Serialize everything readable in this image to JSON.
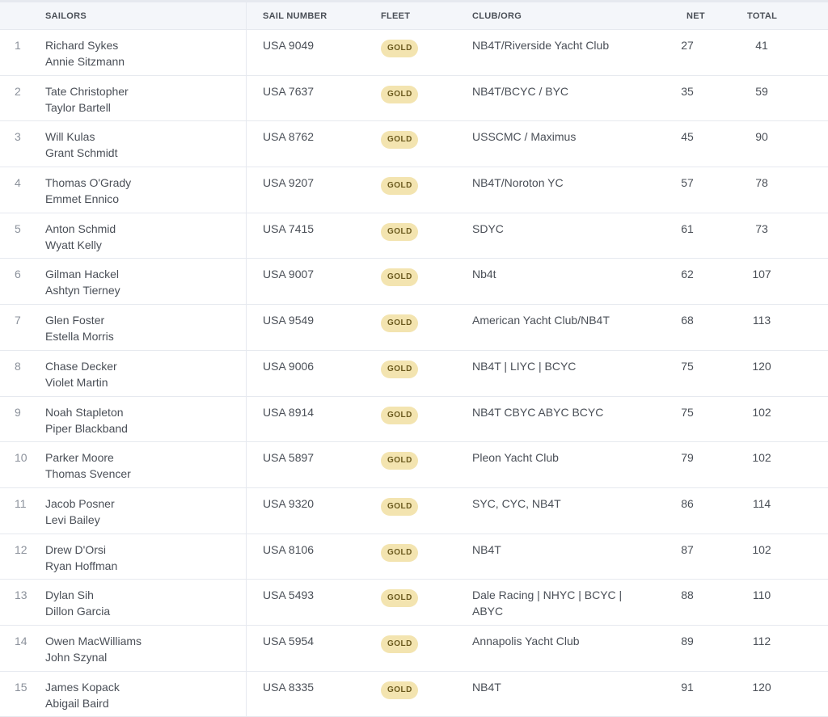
{
  "headers": {
    "sailors": "SAILORS",
    "sail_number": "SAIL NUMBER",
    "fleet": "FLEET",
    "club": "CLUB/ORG",
    "net": "NET",
    "total": "TOTAL"
  },
  "rows": [
    {
      "rank": "1",
      "skipper": "Richard Sykes",
      "crew": "Annie Sitzmann",
      "sail": "USA 9049",
      "fleet": "GOLD",
      "club": "NB4T/Riverside Yacht Club",
      "net": "27",
      "total": "41"
    },
    {
      "rank": "2",
      "skipper": "Tate Christopher",
      "crew": "Taylor Bartell",
      "sail": "USA 7637",
      "fleet": "GOLD",
      "club": "NB4T/BCYC / BYC",
      "net": "35",
      "total": "59"
    },
    {
      "rank": "3",
      "skipper": "Will Kulas",
      "crew": "Grant Schmidt",
      "sail": "USA 8762",
      "fleet": "GOLD",
      "club": "USSCMC / Maximus",
      "net": "45",
      "total": "90"
    },
    {
      "rank": "4",
      "skipper": "Thomas O'Grady",
      "crew": "Emmet Ennico",
      "sail": "USA 9207",
      "fleet": "GOLD",
      "club": "NB4T/Noroton YC",
      "net": "57",
      "total": "78"
    },
    {
      "rank": "5",
      "skipper": "Anton Schmid",
      "crew": "Wyatt Kelly",
      "sail": "USA 7415",
      "fleet": "GOLD",
      "club": "SDYC",
      "net": "61",
      "total": "73"
    },
    {
      "rank": "6",
      "skipper": "Gilman Hackel",
      "crew": "Ashtyn Tierney",
      "sail": "USA 9007",
      "fleet": "GOLD",
      "club": "Nb4t",
      "net": "62",
      "total": "107"
    },
    {
      "rank": "7",
      "skipper": "Glen Foster",
      "crew": "Estella Morris",
      "sail": "USA 9549",
      "fleet": "GOLD",
      "club": "American Yacht Club/NB4T",
      "net": "68",
      "total": "113"
    },
    {
      "rank": "8",
      "skipper": "Chase Decker",
      "crew": "Violet Martin",
      "sail": "USA 9006",
      "fleet": "GOLD",
      "club": "NB4T | LIYC | BCYC",
      "net": "75",
      "total": "120"
    },
    {
      "rank": "9",
      "skipper": "Noah Stapleton",
      "crew": "Piper Blackband",
      "sail": "USA 8914",
      "fleet": "GOLD",
      "club": "NB4T CBYC ABYC BCYC",
      "net": "75",
      "total": "102"
    },
    {
      "rank": "10",
      "skipper": "Parker Moore",
      "crew": "Thomas Svencer",
      "sail": "USA 5897",
      "fleet": "GOLD",
      "club": "Pleon Yacht Club",
      "net": "79",
      "total": "102"
    },
    {
      "rank": "11",
      "skipper": "Jacob Posner",
      "crew": "Levi Bailey",
      "sail": "USA 9320",
      "fleet": "GOLD",
      "club": "SYC, CYC, NB4T",
      "net": "86",
      "total": "114"
    },
    {
      "rank": "12",
      "skipper": "Drew D'Orsi",
      "crew": "Ryan Hoffman",
      "sail": "USA 8106",
      "fleet": "GOLD",
      "club": "NB4T",
      "net": "87",
      "total": "102"
    },
    {
      "rank": "13",
      "skipper": "Dylan Sih",
      "crew": "Dillon Garcia",
      "sail": "USA 5493",
      "fleet": "GOLD",
      "club": "Dale Racing | NHYC | BCYC | ABYC",
      "net": "88",
      "total": "110"
    },
    {
      "rank": "14",
      "skipper": "Owen MacWilliams",
      "crew": "John Szynal",
      "sail": "USA 5954",
      "fleet": "GOLD",
      "club": "Annapolis Yacht Club",
      "net": "89",
      "total": "112"
    },
    {
      "rank": "15",
      "skipper": "James Kopack",
      "crew": "Abigail Baird",
      "sail": "USA 8335",
      "fleet": "GOLD",
      "club": "NB4T",
      "net": "91",
      "total": "120"
    }
  ],
  "colors": {
    "gold_badge_bg": "#f3e4b0",
    "gold_badge_text": "#6b5a1e",
    "header_bg": "#f4f6fa"
  }
}
